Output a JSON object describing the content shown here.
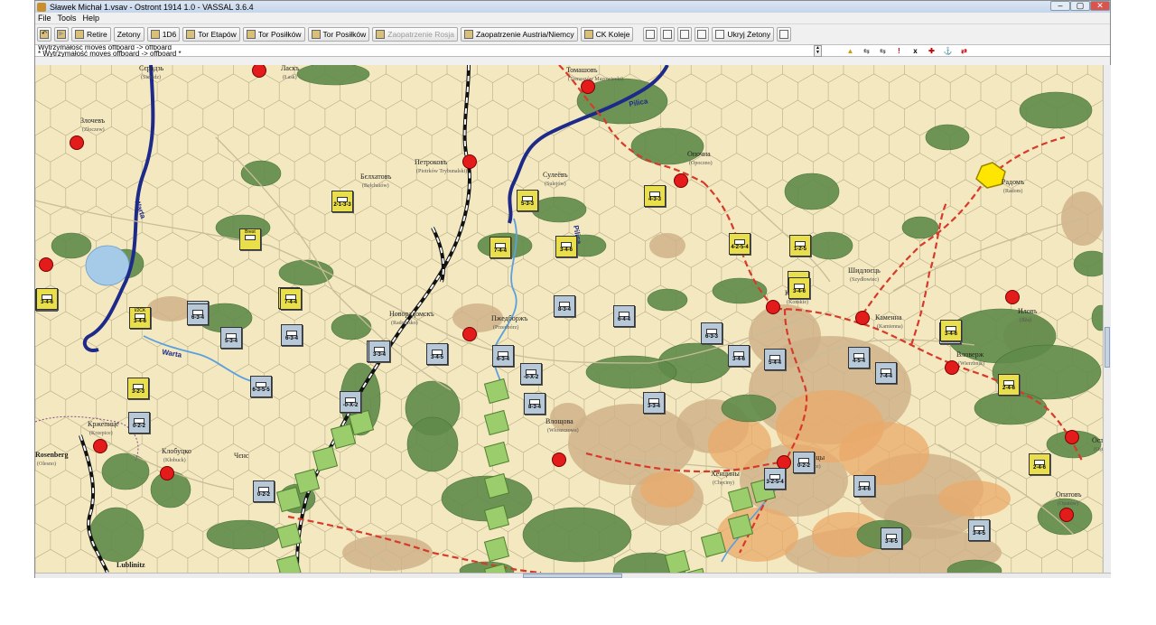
{
  "window": {
    "title": "Sławek Michał 1.vsav - Ostront 1914 1.0 - VASSAL 3.6.4",
    "controls": [
      "–",
      "▢",
      "✕"
    ]
  },
  "menu": [
    "File",
    "Tools",
    "Help"
  ],
  "toolbar": [
    {
      "label": "",
      "icon": "undo-icon",
      "disabled": false
    },
    {
      "label": "",
      "icon": "step-icon",
      "disabled": true
    },
    {
      "label": "Retire",
      "icon": "retire-icon",
      "disabled": false
    },
    {
      "label": "Zetony",
      "icon": "",
      "disabled": false
    },
    {
      "label": "1D6",
      "icon": "dice-icon",
      "disabled": false
    },
    {
      "label": "Tor Etapów",
      "icon": "track-icon",
      "disabled": false
    },
    {
      "label": "Tor Posiłków",
      "icon": "track-icon",
      "disabled": false
    },
    {
      "label": "Tor Posiłków",
      "icon": "track-icon",
      "disabled": false
    },
    {
      "label": "Zaopatrzenie Rosja",
      "icon": "supply-icon",
      "disabled": true
    },
    {
      "label": "Zaopatrzenie Austria/Niemcy",
      "icon": "supply-icon",
      "disabled": false
    },
    {
      "label": "CK Koleje",
      "icon": "rail-icon",
      "disabled": false
    }
  ],
  "toolbar_right": [
    {
      "icon": "camera-icon"
    },
    {
      "icon": "zoom-in-icon"
    },
    {
      "icon": "zoom-select-icon"
    },
    {
      "icon": "zoom-out-icon"
    },
    {
      "label": "Ukryj Żetony",
      "icon": "hide-icon"
    },
    {
      "icon": "battery-icon"
    }
  ],
  "chat": [
    "Wytrzymałość moves offboard -> offboard",
    "* Wytrzymałość moves offboard -> offboard *"
  ],
  "map_buttons": [
    "▲",
    "⇆",
    "⇆",
    "!",
    "x",
    "✚",
    "⚓",
    "⇄"
  ],
  "places": [
    {
      "name": "Сєрадзь",
      "sub": "(Sieradz)"
    },
    {
      "name": "Ласкъ",
      "sub": "(Łask)"
    },
    {
      "name": "Томашовъ",
      "sub": "(Tomaszów Mazowiecki)"
    },
    {
      "name": "Злочевъ",
      "sub": "(Złoczew)"
    },
    {
      "name": "Петроковъ",
      "sub": "(Piotrków Trybunalski)"
    },
    {
      "name": "Сулеёвъ",
      "sub": "(Sulejów)"
    },
    {
      "name": "Опочна",
      "sub": "(Opoczno)"
    },
    {
      "name": "Радомъ",
      "sub": "(Radom)"
    },
    {
      "name": "Бєлхатовъ",
      "sub": "(Bełchatów)"
    },
    {
      "name": "Шидлоєць",
      "sub": "(Szydłowiec)"
    },
    {
      "name": "Конєцъ",
      "sub": "(Końskie)"
    },
    {
      "name": "Иловъ",
      "sub": "(Iłża)"
    },
    {
      "name": "Новорадомскъ",
      "sub": "(Radomsko)"
    },
    {
      "name": "Пжедборжъ",
      "sub": "(Przedbórz)"
    },
    {
      "name": "Каменна",
      "sub": "(Kamienna)"
    },
    {
      "name": "Вловерж",
      "sub": "(Wierzbnik)"
    },
    {
      "name": "Кржепице",
      "sub": "(Krzepice)"
    },
    {
      "name": "Влощова",
      "sub": "(Włoszczowa)"
    },
    {
      "name": "Клобуцко",
      "sub": "(Kłobuck)"
    },
    {
      "name": "Чєнс",
      "sub": ""
    },
    {
      "name": "Кєльцы",
      "sub": "(Kielce)"
    },
    {
      "name": "Хенцины",
      "sub": "(Chęciny)"
    },
    {
      "name": "Остров",
      "sub": "(Ostrowiec)"
    },
    {
      "name": "Опатовъ",
      "sub": "(Opatów)"
    },
    {
      "name": "Rosenberg",
      "sub": "(Olesno)"
    },
    {
      "name": "Lublinitz",
      "sub": ""
    }
  ],
  "rivers": [
    "Warta",
    "Pilica",
    "Warta",
    "Pilica"
  ],
  "counters": [
    {
      "top": "2/Lbr",
      "val": "3-4-6",
      "side": "a"
    },
    {
      "top": "",
      "val": "3-4-6",
      "side": "a"
    },
    {
      "top": "I/2CK",
      "val": "3-4-6",
      "side": "a"
    },
    {
      "top": "",
      "val": "6-3-4",
      "side": "r"
    },
    {
      "top": "Brest",
      "val": "",
      "side": "a"
    },
    {
      "top": "",
      "val": "7-4-4",
      "side": "a"
    },
    {
      "top": "",
      "val": "6-3-4",
      "side": "r"
    },
    {
      "top": "",
      "val": "5-3-4",
      "side": "r"
    },
    {
      "top": "",
      "val": "6-3-4",
      "side": "r"
    },
    {
      "top": "",
      "val": "3-3-4",
      "side": "r"
    },
    {
      "top": "",
      "val": "3-2-3",
      "side": "a"
    },
    {
      "top": "",
      "val": "0-2-2",
      "side": "r"
    },
    {
      "top": "",
      "val": "2-1-3-3",
      "side": "a"
    },
    {
      "top": "",
      "val": "7-4-4",
      "side": "a"
    },
    {
      "top": "",
      "val": "3-3-4",
      "side": "r"
    },
    {
      "top": "",
      "val": "3-4-5",
      "side": "r"
    },
    {
      "top": "",
      "val": "6-3-4",
      "side": "r"
    },
    {
      "top": "",
      "val": "6-3-5-5",
      "side": "r"
    },
    {
      "top": "",
      "val": "-0-X-2",
      "side": "r"
    },
    {
      "top": "",
      "val": "5-3-3",
      "side": "a"
    },
    {
      "top": "",
      "val": "7-4-4",
      "side": "a"
    },
    {
      "top": "",
      "val": "8-3-4",
      "side": "r"
    },
    {
      "top": "",
      "val": "6-4-4",
      "side": "r"
    },
    {
      "top": "",
      "val": "3-4-6",
      "side": "a"
    },
    {
      "top": "",
      "val": "4-3-3",
      "side": "a"
    },
    {
      "top": "",
      "val": "4-2-5-4",
      "side": "a"
    },
    {
      "top": "",
      "val": "1-2-5",
      "side": "a"
    },
    {
      "top": "",
      "val": "3-4-6",
      "side": "a"
    },
    {
      "top": "",
      "val": "3-4-6",
      "side": "a"
    },
    {
      "top": "",
      "val": "6-3-3",
      "side": "r"
    },
    {
      "top": "",
      "val": "3-4-6",
      "side": "r"
    },
    {
      "top": "",
      "val": "5-4-4",
      "side": "r"
    },
    {
      "top": "",
      "val": "4-5-4",
      "side": "r"
    },
    {
      "top": "",
      "val": "7-4-4",
      "side": "r"
    },
    {
      "top": "",
      "val": "3-4-6",
      "side": "r"
    },
    {
      "top": "",
      "val": "3-4-6",
      "side": "a"
    },
    {
      "top": "",
      "val": "2-4-6",
      "side": "a"
    },
    {
      "top": "",
      "val": "-0-X-2",
      "side": "r"
    },
    {
      "top": "",
      "val": "8-3-4",
      "side": "r"
    },
    {
      "top": "",
      "val": "0-2-2",
      "side": "r"
    },
    {
      "top": "",
      "val": "3-2-5-4",
      "side": "r"
    },
    {
      "top": "",
      "val": "3-4-6",
      "side": "r"
    },
    {
      "top": "",
      "val": "3-4-5",
      "side": "r"
    },
    {
      "top": "",
      "val": "3-4-5",
      "side": "r"
    },
    {
      "top": "",
      "val": "2-4-6",
      "side": "a"
    },
    {
      "top": "",
      "val": "3-3-4",
      "side": "r"
    },
    {
      "top": "",
      "val": "0-2-2",
      "side": "r"
    }
  ],
  "colors": {
    "axis_counter": "#e9df4c",
    "russian_counter": "#b7c8d8",
    "green_counter": "#9ccd6d",
    "city": "#e31b1b",
    "rail": "#d63a2a",
    "river": "#1e2a8a",
    "stream": "#5aa0e0",
    "supply_marker": "#ffe600"
  }
}
